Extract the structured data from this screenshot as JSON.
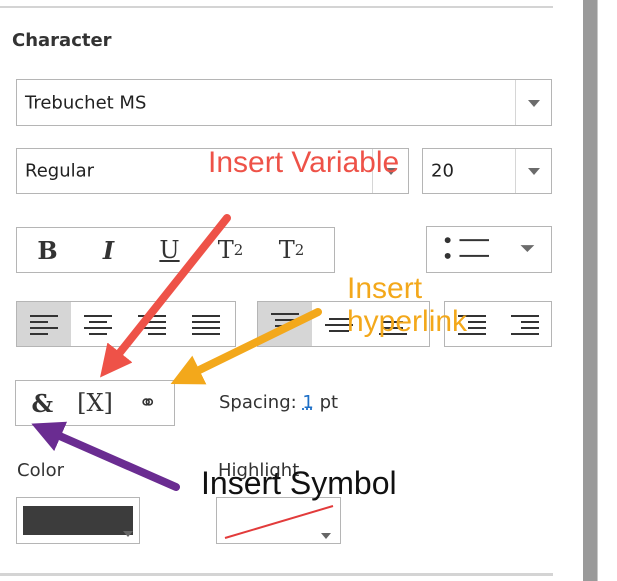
{
  "section": {
    "title": "Character"
  },
  "font_family": {
    "value": "Trebuchet MS"
  },
  "font_style": {
    "value": "Regular"
  },
  "font_size": {
    "value": "20"
  },
  "format_buttons": {
    "bold": "B",
    "italic": "I",
    "underline": "U",
    "superscript_base": "T",
    "superscript_mark": "2",
    "subscript_base": "T",
    "subscript_mark": "2"
  },
  "special_buttons": {
    "symbol": "&",
    "variable": "[X]",
    "hyperlink": "⚭"
  },
  "spacing": {
    "label": "Spacing:",
    "value": "1",
    "unit": "pt"
  },
  "color": {
    "label": "Color",
    "swatch": "#3c3c3c"
  },
  "highlight": {
    "label": "Highlight"
  },
  "annotations": {
    "insert_variable": "Insert Variable",
    "insert_hyperlink": "Insert hyperlink",
    "insert_symbol": "Insert Symbol",
    "variable_color": "#ee5248",
    "hyperlink_color": "#f3a81b",
    "symbol_color": "#6a2c91"
  }
}
